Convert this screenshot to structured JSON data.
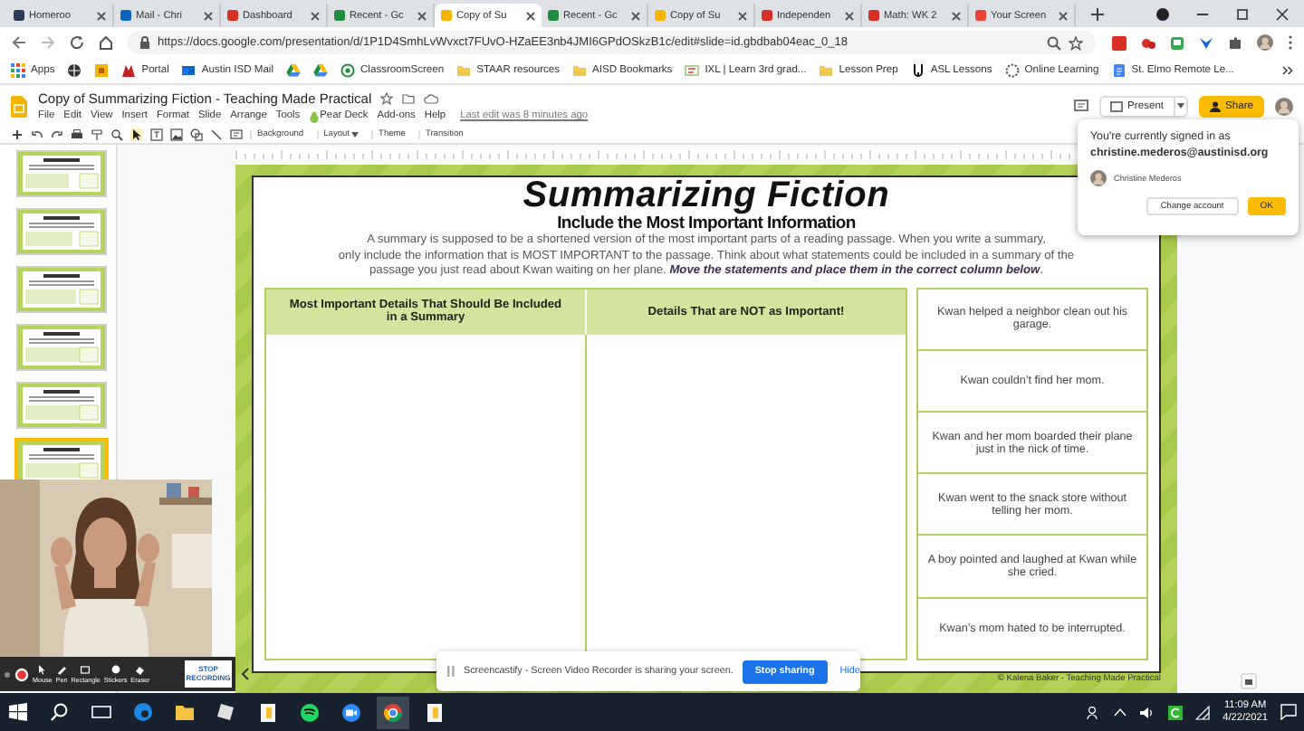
{
  "browser": {
    "tabs": [
      {
        "title": "Homeroo",
        "selected": false
      },
      {
        "title": "Mail - Chri",
        "selected": false
      },
      {
        "title": "Dashboard",
        "selected": false
      },
      {
        "title": "Recent - Gc",
        "selected": false
      },
      {
        "title": "Copy of Su",
        "selected": true
      },
      {
        "title": "Recent - Gc",
        "selected": false
      },
      {
        "title": "Copy of Su",
        "selected": false
      },
      {
        "title": "Independen",
        "selected": false
      },
      {
        "title": "Math: WK 2",
        "selected": false
      },
      {
        "title": "Your Screen",
        "selected": false
      }
    ],
    "address": "https://docs.google.com/presentation/d/1P1D4SmhLvWvxct7FUvO-HZaEE3nb4JMI6GPdOSkzB1c/edit#slide=id.gbdbab04eac_0_18",
    "bookmarks": [
      {
        "kind": "link",
        "label": "Apps"
      },
      {
        "kind": "icon"
      },
      {
        "kind": "icon"
      },
      {
        "kind": "link",
        "label": "Portal"
      },
      {
        "kind": "link",
        "label": "Austin ISD Mail"
      },
      {
        "kind": "icon"
      },
      {
        "kind": "icon"
      },
      {
        "kind": "link",
        "label": "ClassroomScreen"
      },
      {
        "kind": "link",
        "label": "STAAR resources"
      },
      {
        "kind": "link",
        "label": "AISD Bookmarks"
      },
      {
        "kind": "link",
        "label": "IXL | Learn 3rd grad..."
      },
      {
        "kind": "link",
        "label": "Lesson Prep"
      },
      {
        "kind": "link",
        "label": "ASL Lessons"
      },
      {
        "kind": "link",
        "label": "Online Learning"
      },
      {
        "kind": "link",
        "label": "St. Elmo Remote Le..."
      }
    ]
  },
  "document": {
    "title": "Copy of Summarizing Fiction - Teaching Made Practical",
    "menu": [
      "File",
      "Edit",
      "View",
      "Insert",
      "Format",
      "Slide",
      "Arrange",
      "Tools",
      "Pear Deck",
      "Add-ons",
      "Help"
    ],
    "last_edit": "Last edit was 8 minutes ago",
    "toolbar": [
      {
        "label": "Background",
        "dropdown": false
      },
      {
        "label": "Layout",
        "dropdown": true
      },
      {
        "label": "Theme",
        "dropdown": false
      },
      {
        "label": "Transition",
        "dropdown": false
      }
    ],
    "present": "Present",
    "share": "Share"
  },
  "filmstrip": {
    "slides": [
      {
        "selected": false
      },
      {
        "selected": false
      },
      {
        "selected": false
      },
      {
        "selected": false
      },
      {
        "selected": false
      },
      {
        "selected": true
      }
    ]
  },
  "slide": {
    "title": "Summarizing Fiction",
    "subtitle": "Include the Most Important Information",
    "instructions": [
      "A summary is supposed to be a shortened version of the most important parts of a reading passage.  When you write a summary,",
      "only include the information that is MOST IMPORTANT to the passage. Think about what statements could be included in a summary of the",
      "passage you just read about Kwan waiting on her plane.  **Move the statements and place them in the correct column below**."
    ],
    "columns": [
      "Most Important Details That Should Be Included in a Summary",
      "Details That are NOT as Important!"
    ],
    "cards": [
      "Kwan helped a neighbor clean out his garage.",
      "Kwan couldn’t find her mom.",
      "Kwan and her mom boarded their plane just in the nick of time.",
      "Kwan went to the snack store without telling her mom.",
      "A boy pointed and laughed at Kwan while she cried.",
      "Kwan’s mom hated to be interrupted."
    ],
    "credit": "© Kalena Baker - Teaching Made Practical"
  },
  "account_popup": {
    "line": "You're currently signed in as",
    "email": "christine.mederos@austinisd.org",
    "name": "Christine Mederos",
    "change": "Change account",
    "ok": "OK"
  },
  "recorder": {
    "tools": [
      "Mouse",
      "Pen",
      "Rectangle",
      "Stickers",
      "Eraser"
    ],
    "stop": "STOP RECORDING"
  },
  "sharing_bar": {
    "message": "Screencastify - Screen Video Recorder is sharing your screen.",
    "stop": "Stop sharing",
    "hide": "Hide"
  },
  "taskbar": {
    "time": "11:09 AM",
    "date": "4/22/2021"
  }
}
